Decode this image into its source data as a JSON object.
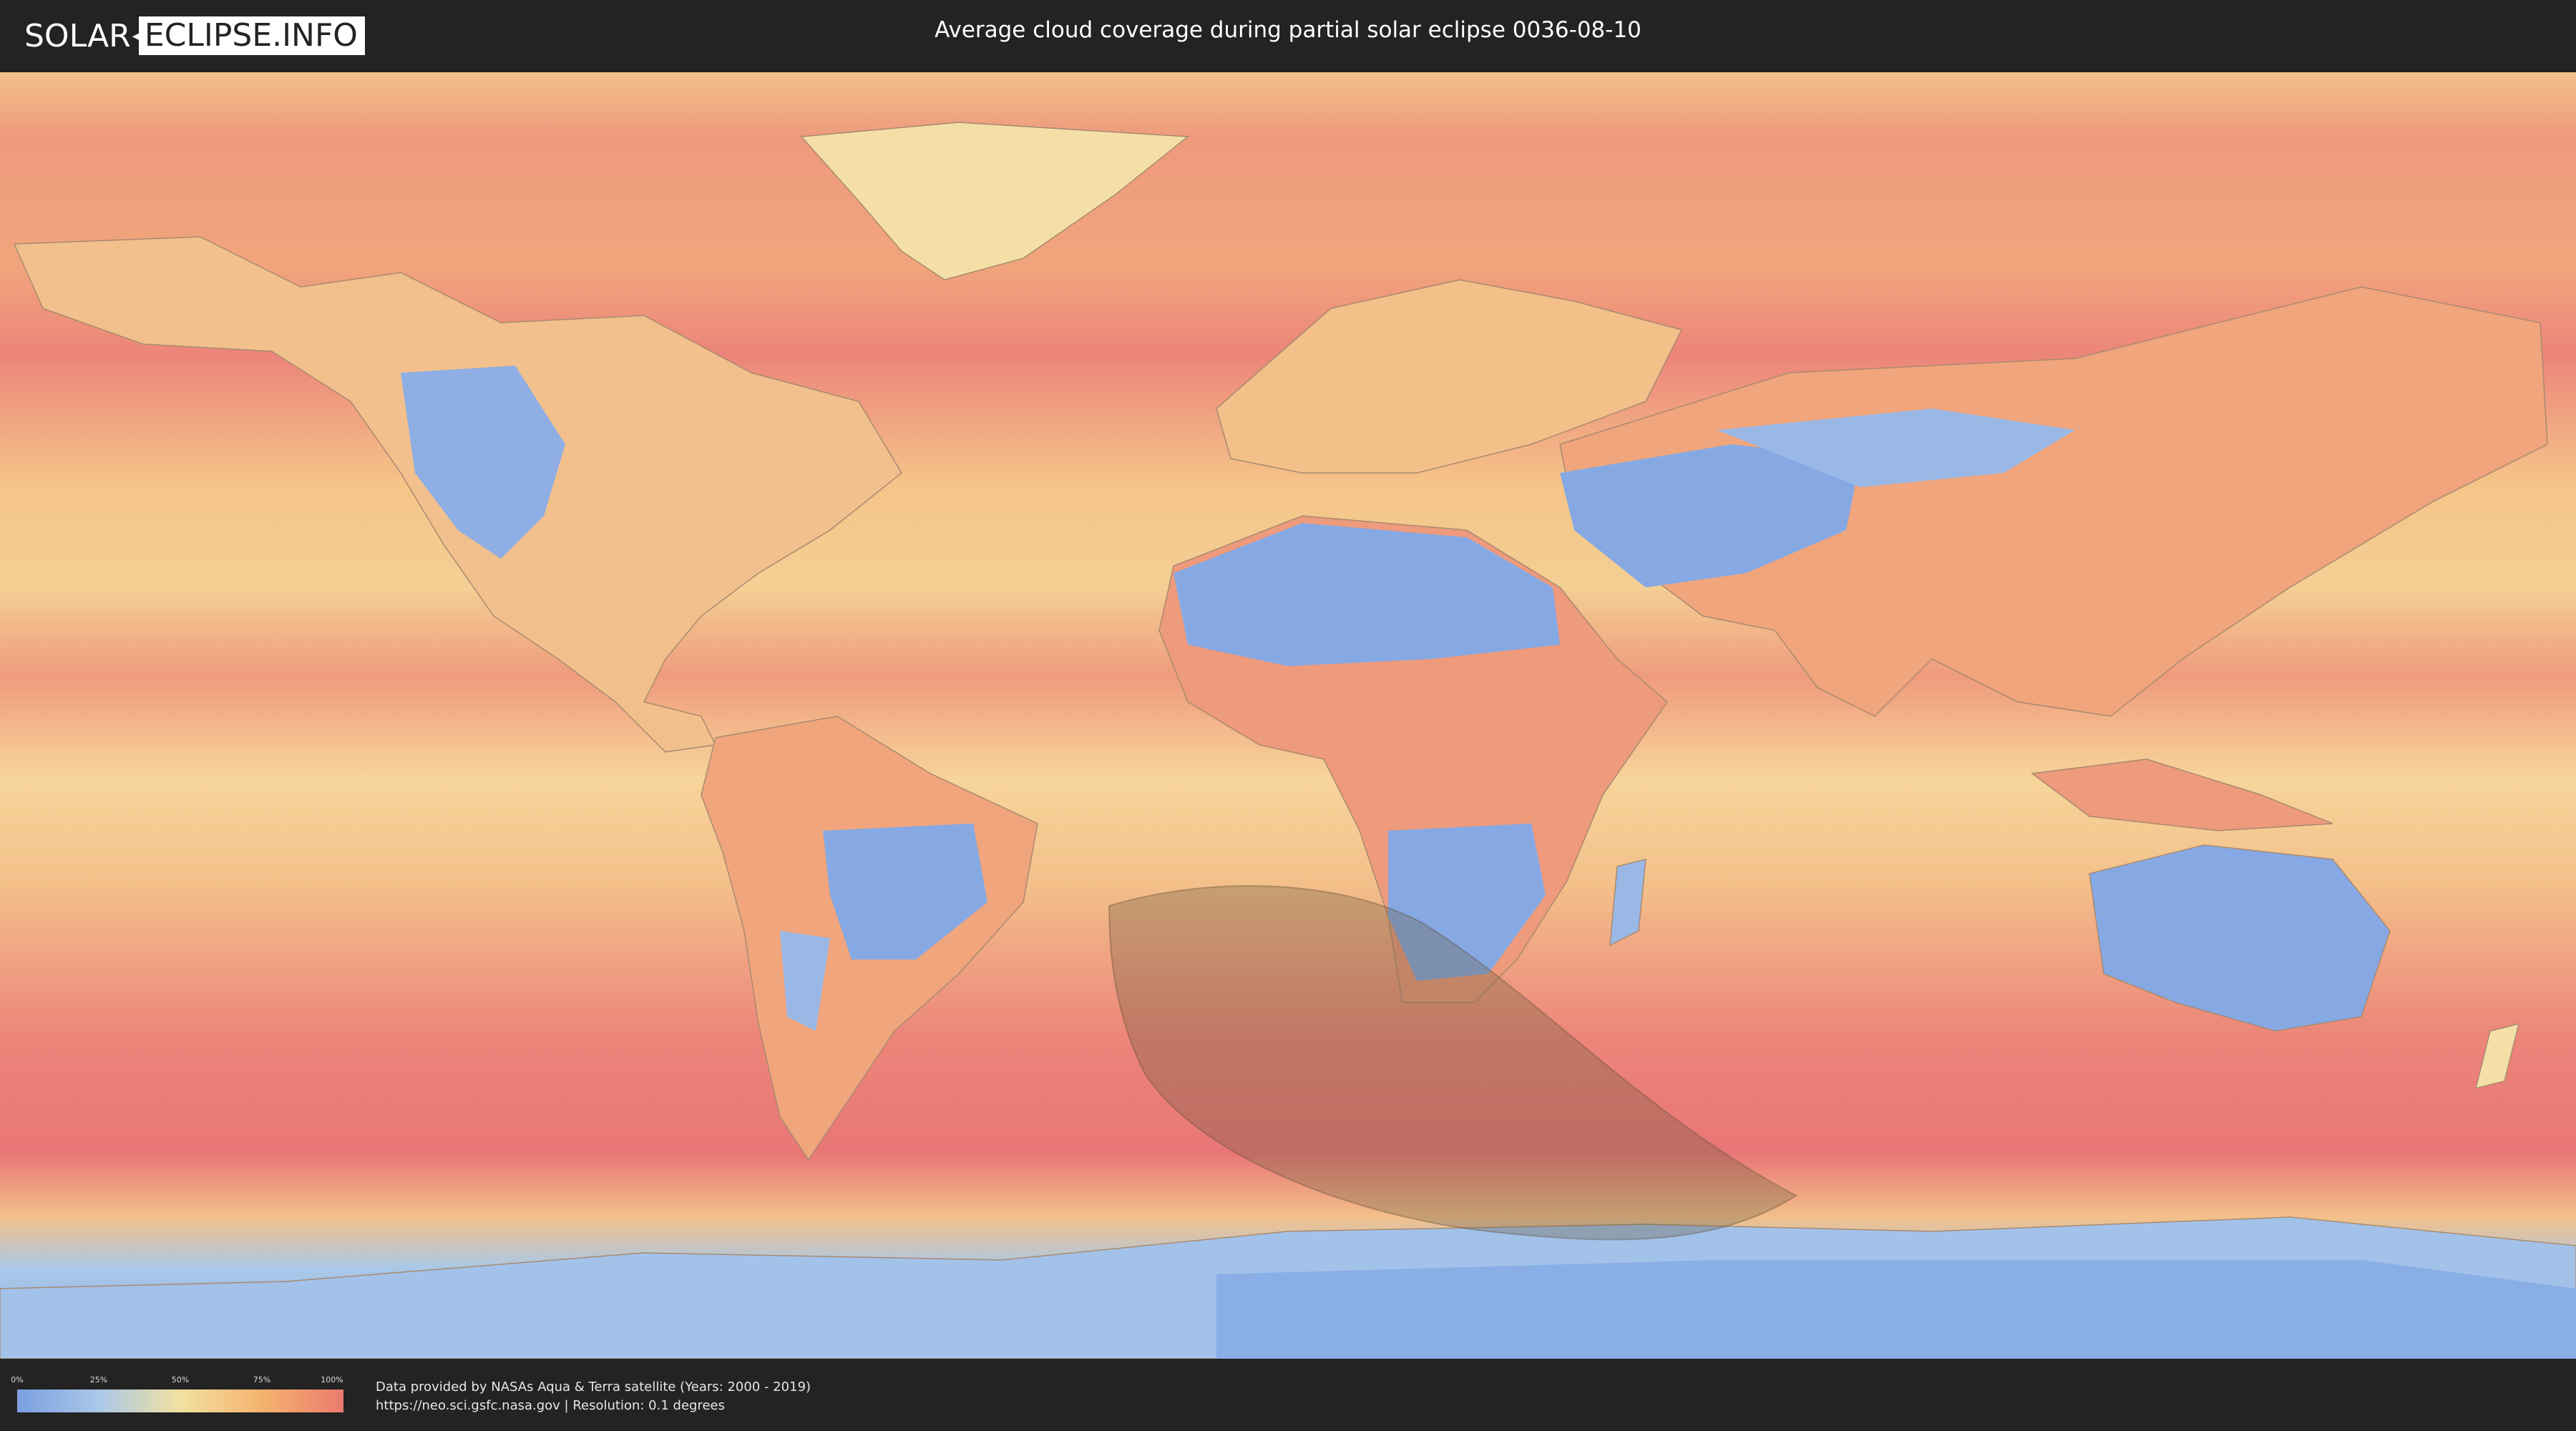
{
  "header": {
    "logo_left": "SOLAR",
    "logo_right": "ECLIPSE.INFO",
    "title": "Average cloud coverage during partial solar eclipse 0036-08-10"
  },
  "legend": {
    "ticks": [
      {
        "label": "0%",
        "fraction": 0.0
      },
      {
        "label": "25%",
        "fraction": 0.25
      },
      {
        "label": "50%",
        "fraction": 0.5
      },
      {
        "label": "75%",
        "fraction": 0.75
      },
      {
        "label": "100%",
        "fraction": 1.0
      }
    ],
    "colors": {
      "low": "#7b9fe0",
      "quarter": "#a9c8e8",
      "mid": "#f2e1a0",
      "three_quarter": "#f4b36f",
      "high": "#ec7a6e"
    }
  },
  "footer": {
    "credit_line1": "Data provided by NASAs Aqua & Terra satellite (Years: 2000 - 2019)",
    "credit_line2": "https://neo.sci.gsfc.nasa.gov | Resolution: 0.1 degrees"
  },
  "map": {
    "projection": "equirectangular",
    "eclipse_overlay": "partial eclipse visibility region over South Atlantic / South Africa",
    "colors": {
      "ocean_cloudy": "#ec857a",
      "mid_cloud": "#f5c489",
      "clear_land": "#86a9e4",
      "shadow": "#7a6a50"
    }
  }
}
